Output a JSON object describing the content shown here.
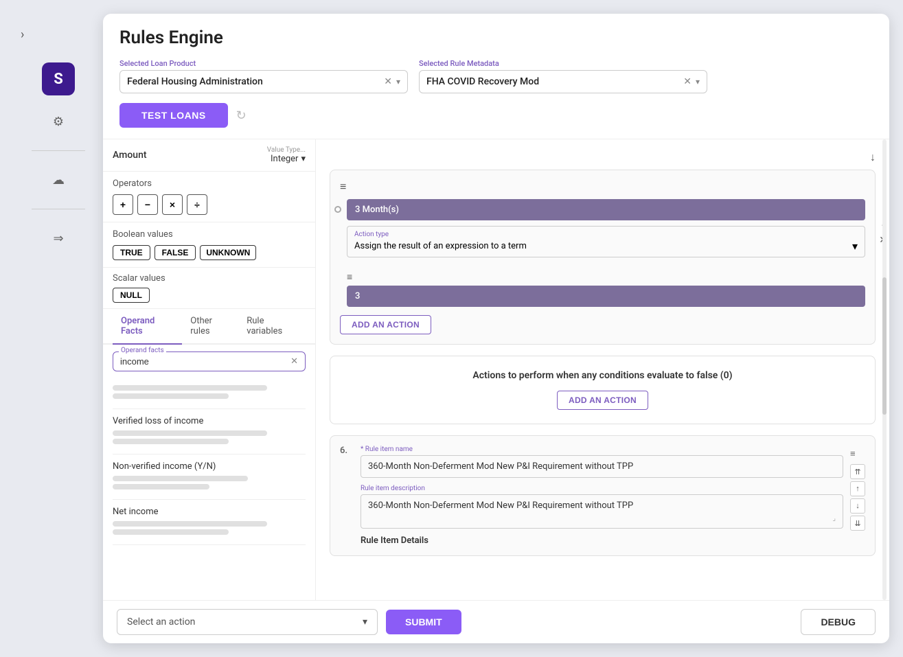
{
  "page": {
    "title": "Rules Engine"
  },
  "sidebar": {
    "logo_letter": "S",
    "chevron": "›",
    "icons": [
      "⚙",
      "☁",
      "→"
    ]
  },
  "header": {
    "loan_product_label": "Selected Loan Product",
    "loan_product_value": "Federal Housing Administration",
    "rule_metadata_label": "Selected Rule Metadata",
    "rule_metadata_value": "FHA COVID Recovery Mod",
    "test_loans_label": "TEST LOANS"
  },
  "left_panel": {
    "amount_label": "Amount",
    "value_type_label": "Value Type...",
    "value_type_value": "Integer",
    "operators_label": "Operators",
    "operators": [
      "+",
      "-",
      "×",
      "÷"
    ],
    "boolean_label": "Boolean values",
    "bool_true": "TRUE",
    "bool_false": "FALSE",
    "bool_unknown": "UNKNOWN",
    "scalar_label": "Scalar values",
    "null_label": "NULL",
    "tabs": [
      "Operand Facts",
      "Other rules",
      "Rule variables"
    ],
    "active_tab": "Operand Facts",
    "search_label": "Operand facts",
    "search_value": "income",
    "facts": [
      {
        "name": "Verified loss of income"
      },
      {
        "name": "Non-verified income (Y/N)"
      },
      {
        "name": "Net income"
      }
    ]
  },
  "right_panel": {
    "true_action_bar_1": "3 Month(s)",
    "action_type_label": "Action type",
    "action_type_value": "Assign the result of an expression to a term",
    "true_action_bar_2": "3",
    "add_action_label": "ADD AN ACTION",
    "false_actions_title": "Actions to perform when any conditions evaluate to false (0)",
    "false_add_action_label": "ADD AN ACTION",
    "rule_item_number": "6.",
    "rule_item_name_label": "* Rule item name",
    "rule_item_name_value": "360-Month Non-Deferment Mod New P&I Requirement without TPP",
    "rule_item_desc_label": "Rule item description",
    "rule_item_desc_value": "360-Month Non-Deferment Mod New P&I Requirement without TPP",
    "rule_item_details_label": "Rule Item Details"
  },
  "bottom_bar": {
    "select_action_placeholder": "Select an action",
    "submit_label": "SUBMIT",
    "debug_label": "DEBUG"
  }
}
